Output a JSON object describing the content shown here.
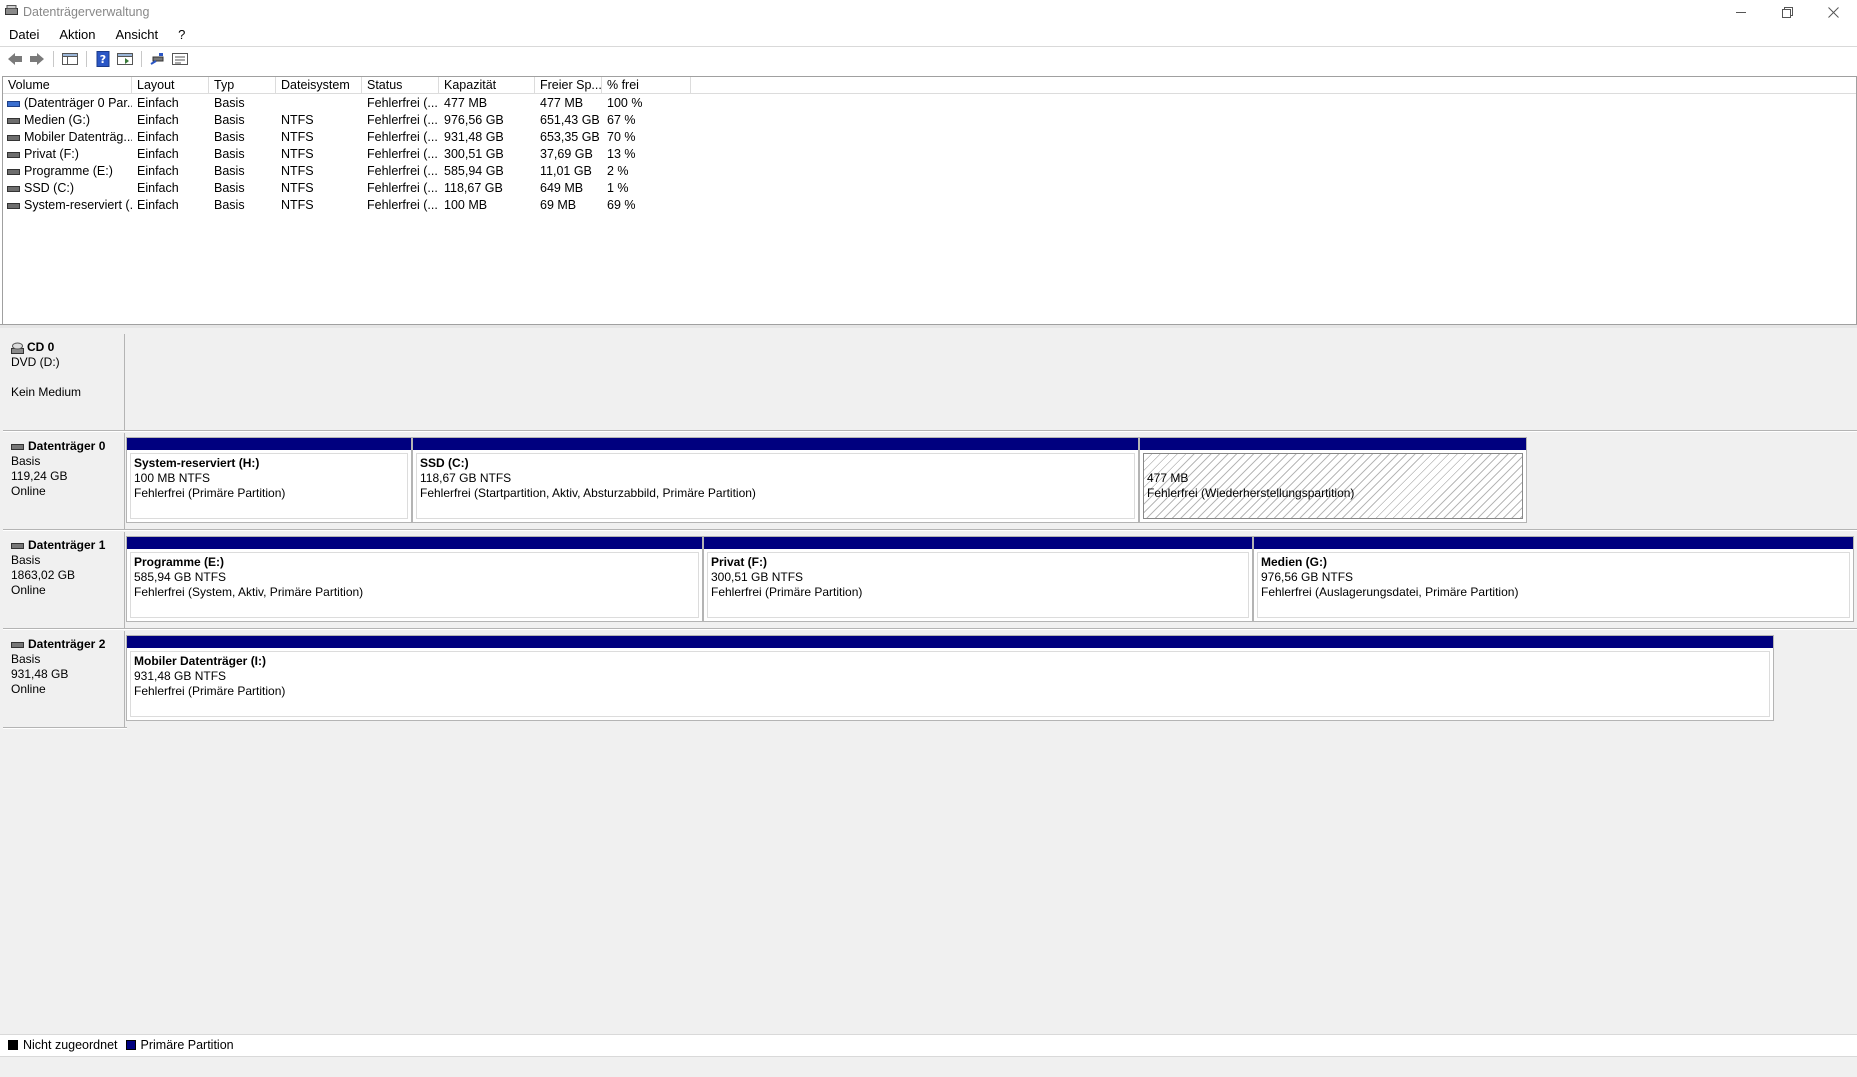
{
  "window": {
    "title": "Datenträgerverwaltung"
  },
  "menu": [
    "Datei",
    "Aktion",
    "Ansicht",
    "?"
  ],
  "toolbar": {
    "icons": [
      "back-icon",
      "forward-icon",
      "show-pane-icon",
      "help-icon",
      "properties-icon",
      "connect-icon",
      "settings-icon"
    ]
  },
  "columns": [
    "Volume",
    "Layout",
    "Typ",
    "Dateisystem",
    "Status",
    "Kapazität",
    "Freier Sp...",
    "% frei"
  ],
  "volumes": [
    {
      "volume": "(Datenträger 0 Par...",
      "layout": "Einfach",
      "typ": "Basis",
      "fs": "",
      "status": "Fehlerfrei (...",
      "capacity": "477 MB",
      "free": "477 MB",
      "pct": "100 %",
      "icon": "blue"
    },
    {
      "volume": "Medien (G:)",
      "layout": "Einfach",
      "typ": "Basis",
      "fs": "NTFS",
      "status": "Fehlerfrei (...",
      "capacity": "976,56 GB",
      "free": "651,43 GB",
      "pct": "67 %",
      "icon": "gray"
    },
    {
      "volume": "Mobiler Datenträg...",
      "layout": "Einfach",
      "typ": "Basis",
      "fs": "NTFS",
      "status": "Fehlerfrei (...",
      "capacity": "931,48 GB",
      "free": "653,35 GB",
      "pct": "70 %",
      "icon": "gray"
    },
    {
      "volume": "Privat (F:)",
      "layout": "Einfach",
      "typ": "Basis",
      "fs": "NTFS",
      "status": "Fehlerfrei (...",
      "capacity": "300,51 GB",
      "free": "37,69 GB",
      "pct": "13 %",
      "icon": "gray"
    },
    {
      "volume": "Programme (E:)",
      "layout": "Einfach",
      "typ": "Basis",
      "fs": "NTFS",
      "status": "Fehlerfrei (...",
      "capacity": "585,94 GB",
      "free": "11,01 GB",
      "pct": "2 %",
      "icon": "gray"
    },
    {
      "volume": "SSD (C:)",
      "layout": "Einfach",
      "typ": "Basis",
      "fs": "NTFS",
      "status": "Fehlerfrei (...",
      "capacity": "118,67 GB",
      "free": "649 MB",
      "pct": "1 %",
      "icon": "gray"
    },
    {
      "volume": "System-reserviert (...",
      "layout": "Einfach",
      "typ": "Basis",
      "fs": "NTFS",
      "status": "Fehlerfrei (...",
      "capacity": "100 MB",
      "free": "69 MB",
      "pct": "69 %",
      "icon": "gray"
    }
  ],
  "cd": {
    "name": "CD 0",
    "drive": "DVD (D:)",
    "medium": "Kein Medium"
  },
  "disks": [
    {
      "name": "Datenträger 0",
      "type": "Basis",
      "size": "119,24 GB",
      "state": "Online",
      "partitions": [
        {
          "name": "System-reserviert  (H:)",
          "size": "100 MB NTFS",
          "status": "Fehlerfrei (Primäre Partition)"
        },
        {
          "name": "SSD  (C:)",
          "size": "118,67 GB NTFS",
          "status": "Fehlerfrei (Startpartition, Aktiv, Absturzabbild, Primäre Partition)"
        },
        {
          "name": "",
          "size": "477 MB",
          "status": "Fehlerfrei (Wiederherstellungspartition)"
        }
      ]
    },
    {
      "name": "Datenträger 1",
      "type": "Basis",
      "size": "1863,02 GB",
      "state": "Online",
      "partitions": [
        {
          "name": "Programme  (E:)",
          "size": "585,94 GB NTFS",
          "status": "Fehlerfrei (System, Aktiv, Primäre Partition)"
        },
        {
          "name": "Privat  (F:)",
          "size": "300,51 GB NTFS",
          "status": "Fehlerfrei (Primäre Partition)"
        },
        {
          "name": "Medien  (G:)",
          "size": "976,56 GB NTFS",
          "status": "Fehlerfrei (Auslagerungsdatei, Primäre Partition)"
        }
      ]
    },
    {
      "name": "Datenträger 2",
      "type": "Basis",
      "size": "931,48 GB",
      "state": "Online",
      "partitions": [
        {
          "name": "Mobiler Datenträger  (I:)",
          "size": "931,48 GB NTFS",
          "status": "Fehlerfrei (Primäre Partition)"
        }
      ]
    }
  ],
  "legend": [
    {
      "label": "Nicht zugeordnet",
      "color": "#000000"
    },
    {
      "label": "Primäre Partition",
      "color": "#00007f"
    }
  ],
  "colors": {
    "partition_bar": "#00007f",
    "pane_bg": "#f0f0f0"
  }
}
